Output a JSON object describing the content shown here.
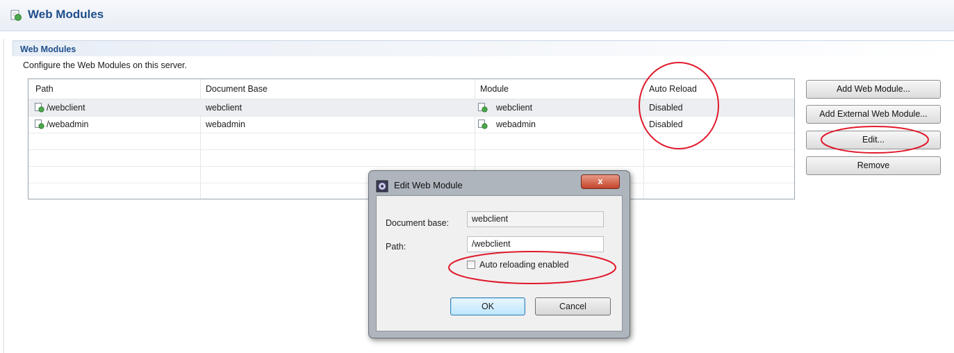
{
  "page": {
    "title": "Web Modules",
    "title_icon": "web-module-icon"
  },
  "section": {
    "title": "Web Modules",
    "description": "Configure the Web Modules on this server."
  },
  "table": {
    "headers": [
      "Path",
      "Document Base",
      "Module",
      "Auto Reload"
    ],
    "rows": [
      {
        "path": "/webclient",
        "doc_base": "webclient",
        "module": "webclient",
        "auto_reload": "Disabled"
      },
      {
        "path": "/webadmin",
        "doc_base": "webadmin",
        "module": "webadmin",
        "auto_reload": "Disabled"
      }
    ]
  },
  "buttons": {
    "add": "Add Web Module...",
    "add_external": "Add External Web Module...",
    "edit": "Edit...",
    "remove": "Remove"
  },
  "dialog": {
    "title": "Edit Web Module",
    "close_label": "x",
    "document_base_label": "Document base:",
    "document_base_value": "webclient",
    "path_label": "Path:",
    "path_value": "/webclient",
    "checkbox_label": "Auto reloading enabled",
    "checkbox_checked": false,
    "ok_label": "OK",
    "cancel_label": "Cancel"
  },
  "colors": {
    "title_blue": "#1f4f8b",
    "annotation_red": "#e0192b"
  }
}
